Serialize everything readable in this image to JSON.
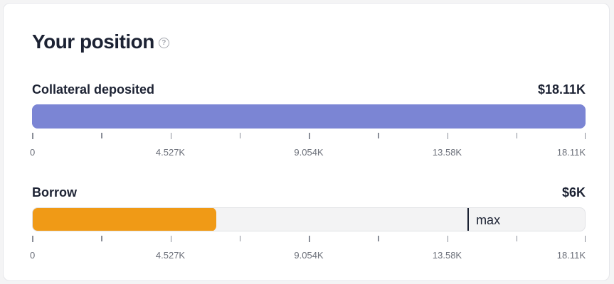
{
  "position": {
    "title": "Your position",
    "help_icon": "question-circle-icon",
    "collateral": {
      "label": "Collateral deposited",
      "value": "$18.11K",
      "fill_fraction": 1.0,
      "color": "#7b85d4",
      "axis_ticks": [
        "0",
        "4.527K",
        "9.054K",
        "13.58K",
        "18.11K"
      ]
    },
    "borrow": {
      "label": "Borrow",
      "value": "$6K",
      "fill_fraction": 0.331,
      "max_fraction": 0.788,
      "max_label": "max",
      "color": "#f09a16",
      "axis_ticks": [
        "0",
        "4.527K",
        "9.054K",
        "13.58K",
        "18.11K"
      ]
    }
  }
}
